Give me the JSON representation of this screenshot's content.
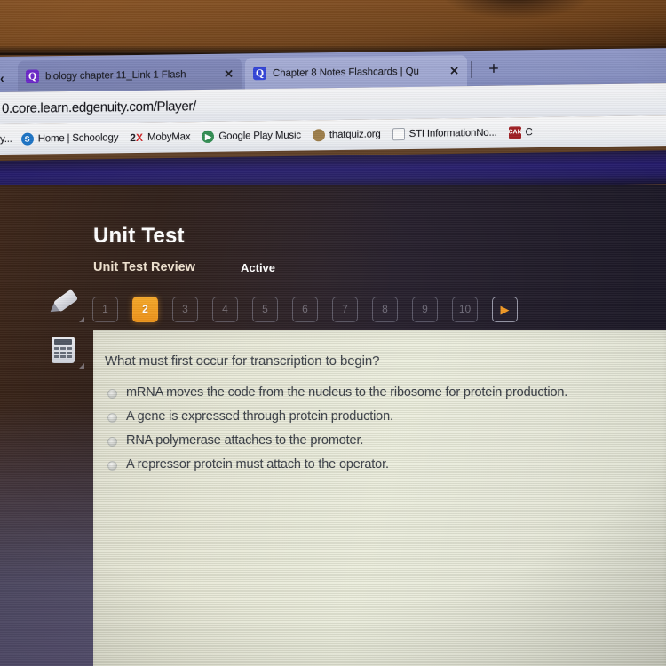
{
  "browser": {
    "back_chevron": "‹",
    "tabs": [
      {
        "icon": "quizlet-icon",
        "title": "biology chapter 11_Link 1 Flash",
        "close": "✕",
        "active": false
      },
      {
        "icon": "quizlet-icon",
        "title": "Chapter 8 Notes Flashcards | Qu",
        "close": "✕",
        "active": true
      }
    ],
    "new_tab_label": "+",
    "url": "0.core.learn.edgenuity.com/Player/",
    "bookmarks": [
      {
        "label": "y...",
        "icon": "bookmark-icon"
      },
      {
        "label": "Home | Schoology",
        "icon": "schoology-icon",
        "glyph": "S"
      },
      {
        "label": "MobyMax",
        "icon": "mobymax-icon",
        "glyph": "2X"
      },
      {
        "label": "Google Play Music",
        "icon": "google-play-music-icon",
        "glyph": "▶"
      },
      {
        "label": "thatquiz.org",
        "icon": "thatquiz-icon",
        "glyph": ""
      },
      {
        "label": "STI InformationNo...",
        "icon": "document-icon",
        "glyph": ""
      },
      {
        "label": "C",
        "icon": "red-site-icon",
        "glyph": "CAN"
      }
    ]
  },
  "assessment": {
    "title": "Unit Test",
    "subtitle": "Unit Test Review",
    "status": "Active",
    "current_question": "2",
    "question_buttons": [
      "1",
      "2",
      "3",
      "4",
      "5",
      "6",
      "7",
      "8",
      "9",
      "10"
    ],
    "next_button_label": "▶",
    "tools": [
      {
        "name": "highlighter-tool",
        "label": "Highlighter"
      },
      {
        "name": "calculator-tool",
        "label": "Calculator"
      }
    ]
  },
  "question": {
    "prompt": "What must first occur for transcription to begin?",
    "choices": [
      "mRNA moves the code from the nucleus to the ribosome for protein production.",
      "A gene is expressed through protein production.",
      "RNA polymerase attaches to the promoter.",
      "A repressor protein must attach to the operator."
    ]
  },
  "colors": {
    "accent_orange": "#f0951e",
    "tab_strip": "#8992c2",
    "navy_band": "#241b6b",
    "card_cream": "#e5e6d4",
    "page_dark": "#1e1724"
  }
}
